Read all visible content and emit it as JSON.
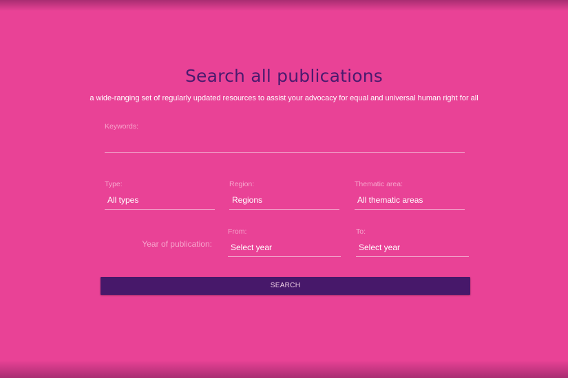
{
  "header": {
    "title": "Search all publications",
    "subtitle": "a wide-ranging set of regularly updated resources to assist your advocacy for equal and universal human right for all"
  },
  "form": {
    "keywords": {
      "label": "Keywords:",
      "value": ""
    },
    "type": {
      "label": "Type:",
      "value": "All types"
    },
    "region": {
      "label": "Region:",
      "value": "Regions"
    },
    "thematic_area": {
      "label": "Thematic area:",
      "value": "All thematic areas"
    },
    "year_of_publication": {
      "label": "Year of publication:",
      "from": {
        "label": "From:",
        "value": "Select year"
      },
      "to": {
        "label": "To:",
        "value": "Select year"
      }
    },
    "search_button_label": "SEARCH"
  },
  "colors": {
    "background": "#e94296",
    "title": "#4a1a6e",
    "button": "#47186a",
    "label": "#f7a6cd"
  }
}
